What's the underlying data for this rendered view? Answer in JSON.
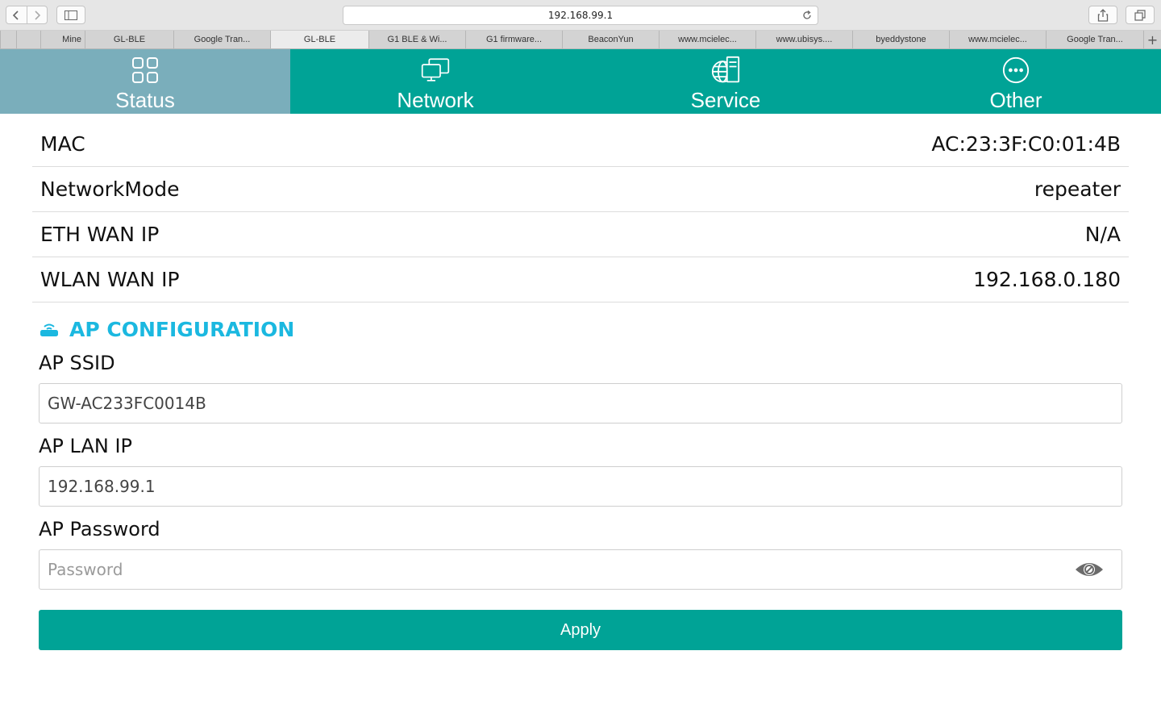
{
  "browser": {
    "address": "192.168.99.1",
    "tabs": [
      {
        "label": "Mine",
        "active": false
      },
      {
        "label": "GL-BLE",
        "active": false
      },
      {
        "label": "Google Tran...",
        "active": false
      },
      {
        "label": "GL-BLE",
        "active": true
      },
      {
        "label": "G1 BLE & Wi...",
        "active": false
      },
      {
        "label": "G1 firmware...",
        "active": false
      },
      {
        "label": "BeaconYun",
        "active": false
      },
      {
        "label": "www.mcielec...",
        "active": false
      },
      {
        "label": "www.ubisys....",
        "active": false
      },
      {
        "label": "byeddystone",
        "active": false
      },
      {
        "label": "www.mcielec...",
        "active": false
      },
      {
        "label": "Google Tran...",
        "active": false
      }
    ],
    "new_tab": "+"
  },
  "nav": {
    "items": [
      {
        "label": "Status",
        "icon": "grid-icon",
        "active": true
      },
      {
        "label": "Network",
        "icon": "monitors-icon",
        "active": false
      },
      {
        "label": "Service",
        "icon": "globe-server-icon",
        "active": false
      },
      {
        "label": "Other",
        "icon": "more-icon",
        "active": false
      }
    ]
  },
  "status": {
    "rows": [
      {
        "label": "MAC",
        "value": "AC:23:3F:C0:01:4B"
      },
      {
        "label": "NetworkMode",
        "value": "repeater"
      },
      {
        "label": "ETH WAN IP",
        "value": "N/A"
      },
      {
        "label": "WLAN WAN IP",
        "value": "192.168.0.180"
      }
    ]
  },
  "ap_config": {
    "title": "AP CONFIGURATION",
    "icon": "router-icon",
    "ssid_label": "AP SSID",
    "ssid_value": "GW-AC233FC0014B",
    "lan_ip_label": "AP LAN IP",
    "lan_ip_value": "192.168.99.1",
    "password_label": "AP Password",
    "password_placeholder": "Password",
    "apply_label": "Apply"
  },
  "colors": {
    "accent": "#00a396",
    "active_tab": "#7aaebb",
    "section_title": "#1bb8e0"
  }
}
